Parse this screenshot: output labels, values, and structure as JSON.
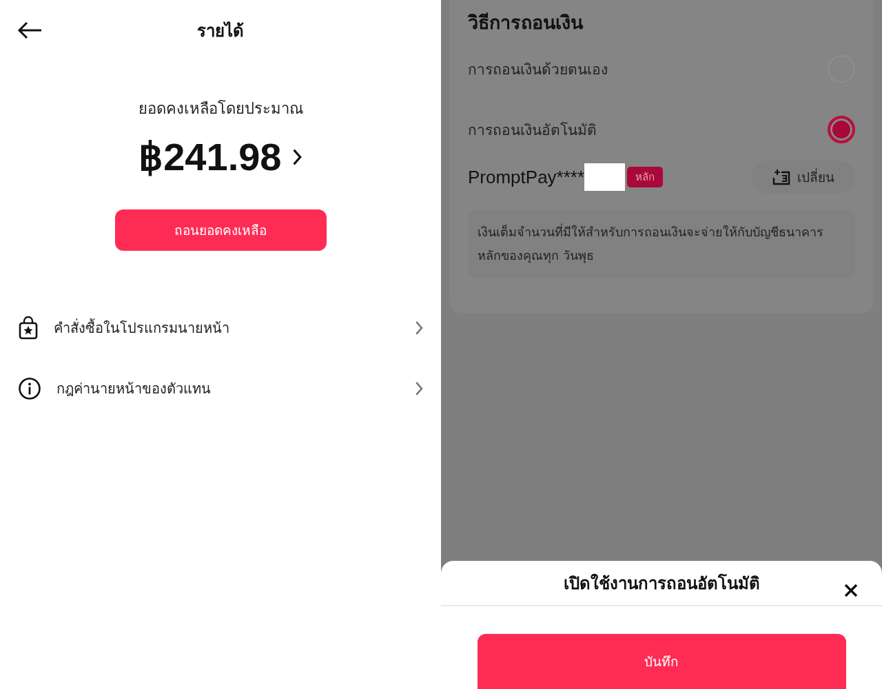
{
  "earnings": {
    "title": "รายได้",
    "balance_label": "ยอดคงเหลือโดยประมาณ",
    "balance": "฿241.98",
    "withdraw_button": "ถอนยอดคงเหลือ",
    "menu": [
      {
        "kind": "bag",
        "label": "คำสั่งซื้อในโปรแกรมนายหน้า"
      },
      {
        "kind": "info",
        "label": "กฎค่านายหน้าของตัวแทน"
      }
    ]
  },
  "withdrawal": {
    "title": "วิธีการถอนเงิน",
    "options": [
      {
        "label": "การถอนเงินด้วยตนเอง",
        "selected": false
      },
      {
        "label": "การถอนเงินอัตโนมัติ",
        "selected": true
      }
    ],
    "account": {
      "name": "PromptPay****",
      "redacted": true,
      "badge": "หลัก",
      "change_button": "เปลี่ยน"
    },
    "note": "เงินเต็มจำนวนที่มีให้สำหรับการถอนเงินจะจ่ายให้กับบัญชีธนาคารหลักของคุณทุก วันพุธ"
  },
  "sheet": {
    "title": "เปิดใช้งานการถอนอัตโนมัติ",
    "save_button": "บันทึก"
  }
}
